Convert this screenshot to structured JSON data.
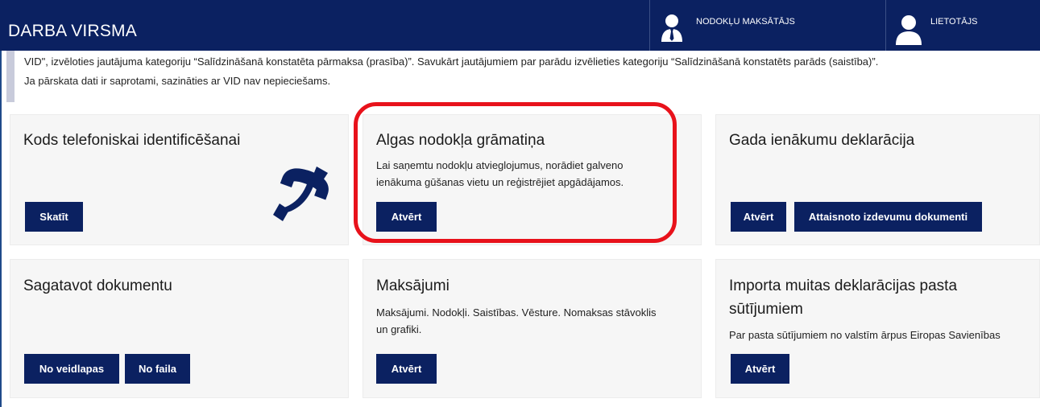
{
  "header": {
    "title": "DARBA VIRSMA",
    "taxpayer_label": "NODOKĻU MAKSĀTĀJS",
    "user_label": "LIETOTĀJS"
  },
  "notice": {
    "line1": "VID\", izvēloties jautājuma kategoriju “Salīdzināšanā konstatēta pārmaksa (prasība)”. Savukārt jautājumiem par parādu izvēlieties kategoriju “Salīdzināšanā konstatēts parāds (saistība)”.",
    "line2": "Ja pārskata dati ir saprotami, sazināties ar VID nav nepieciešams."
  },
  "cards": {
    "phone": {
      "title": "Kods telefoniskai identificēšanai",
      "view_button": "Skatīt"
    },
    "tax_book": {
      "title": "Algas nodokļa grāmatiņa",
      "desc_line1": "Lai saņemtu nodokļu atvieglojumus, norādiet galveno",
      "desc_line2": "ienākuma gūšanas vietu un reģistrējiet apgādājamos.",
      "open_button": "Atvērt"
    },
    "annual": {
      "title": "Gada ienākumu deklarācija",
      "open_button": "Atvērt",
      "docs_button": "Attaisnoto izdevumu dokumenti"
    },
    "prepare": {
      "title": "Sagatavot dokumentu",
      "form_button": "No veidlapas",
      "file_button": "No faila"
    },
    "payments": {
      "title": "Maksājumi",
      "desc_line1": "Maksājumi. Nodokļi. Saistības. Vēsture. Nomaksas stāvoklis",
      "desc_line2": "un grafiki.",
      "open_button": "Atvērt"
    },
    "customs": {
      "title_line1": "Importa muitas deklarācijas pasta",
      "title_line2": "sūtījumiem",
      "desc": "Par pasta sūtījumiem no valstīm ārpus Eiropas Savienības",
      "open_button": "Atvērt"
    }
  },
  "colors": {
    "navy": "#0b2161",
    "highlight": "#e8121b",
    "card_bg": "#f6f6f6"
  },
  "icons": [
    "user-tie-icon",
    "user-icon",
    "phone-icon"
  ]
}
